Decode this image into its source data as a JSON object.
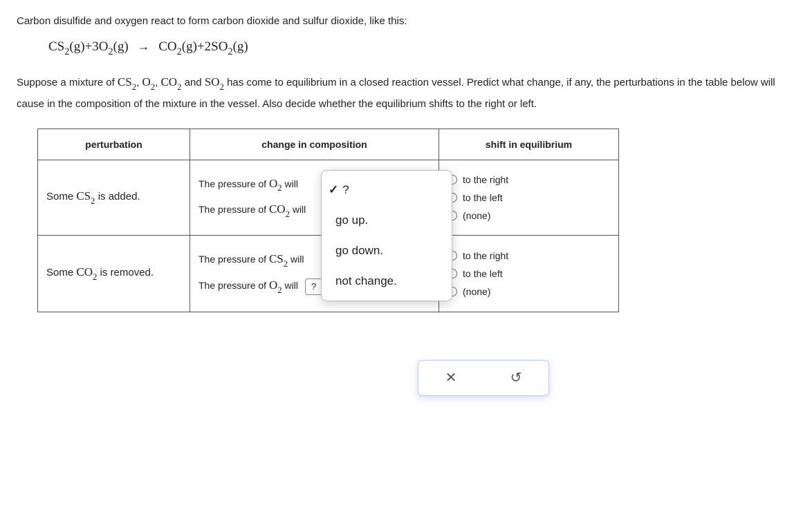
{
  "intro": "Carbon disulfide and oxygen react to form carbon dioxide and sulfur dioxide, like this:",
  "equation": {
    "left1": "CS",
    "left1_sub": "2",
    "left1_state": "(g)",
    "plus1": "+3O",
    "plus1_sub": "2",
    "plus1_state": "(g)",
    "arrow": "→",
    "right1": "CO",
    "right1_sub": "2",
    "right1_state": "(g)",
    "plus2": "+2SO",
    "plus2_sub": "2",
    "plus2_state": "(g)"
  },
  "context_pre": "Suppose a mixture of ",
  "species": {
    "a": "CS",
    "a_sub": "2",
    "b": "O",
    "b_sub": "2",
    "c": "CO",
    "c_sub": "2",
    "d": "SO",
    "d_sub": "2"
  },
  "context_mid1": ", ",
  "context_mid2": ", ",
  "context_mid3": " and ",
  "context_post": " has come to equilibrium in a closed reaction vessel. Predict what change, if any, the perturbations in the table below will cause in the composition of the mixture in the vessel. Also decide whether the equilibrium shifts to the right or left.",
  "headers": {
    "perturbation": "perturbation",
    "change": "change in composition",
    "shift": "shift in equilibrium"
  },
  "rows": [
    {
      "perturbation_pre": "Some ",
      "perturbation_species": "CS",
      "perturbation_sub": "2",
      "perturbation_post": " is added.",
      "line1_pre": "The pressure of ",
      "line1_species": "O",
      "line1_sub": "2",
      "line1_post": " will",
      "line2_pre": "The pressure of ",
      "line2_species": "CO",
      "line2_sub": "2",
      "line2_post": " will"
    },
    {
      "perturbation_pre": "Some ",
      "perturbation_species": "CO",
      "perturbation_sub": "2",
      "perturbation_post": " is removed.",
      "line1_pre": "The pressure of ",
      "line1_species": "CS",
      "line1_sub": "2",
      "line1_post": " will",
      "line2_pre": "The pressure of ",
      "line2_species": "O",
      "line2_sub": "2",
      "line2_post": " will"
    }
  ],
  "shift_options": {
    "right": "to the right",
    "left": "to the left",
    "none": "(none)"
  },
  "dropdown": {
    "placeholder": "?",
    "options": {
      "q": "?",
      "up": "go up.",
      "down": "go down.",
      "nochange": "not change."
    }
  },
  "helper": {
    "close": "✕",
    "reset": "↺"
  }
}
